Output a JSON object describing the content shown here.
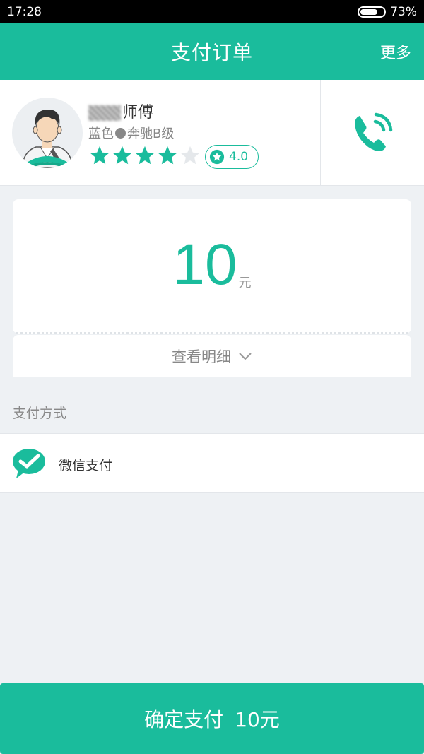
{
  "status_bar": {
    "time": "17:28",
    "battery_percent": "73%",
    "battery_level": 0.73
  },
  "header": {
    "title": "支付订单",
    "more": "更多"
  },
  "driver": {
    "name_suffix": "师傅",
    "car_color": "蓝色",
    "car_model": "奔驰B级",
    "stars_filled": 4,
    "stars_total": 5,
    "rating": "4.0"
  },
  "amount": {
    "value": "10",
    "unit": "元"
  },
  "detail": {
    "label": "查看明细"
  },
  "payment": {
    "section_label": "支付方式",
    "method_label": "微信支付"
  },
  "confirm": {
    "label": "确定支付",
    "amount": "10元"
  },
  "colors": {
    "accent": "#1abc9c",
    "background": "#eef1f4",
    "star_empty": "#e5e8eb"
  }
}
